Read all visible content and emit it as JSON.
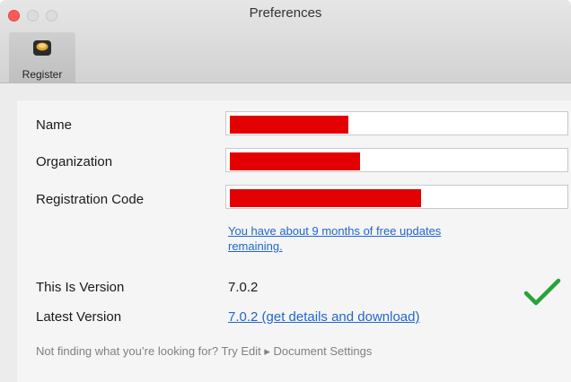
{
  "window": {
    "title": "Preferences"
  },
  "toolbar": {
    "tab_label": "Register",
    "tab_icon": "register-app-icon"
  },
  "form": {
    "name_label": "Name",
    "organization_label": "Organization",
    "registration_code_label": "Registration Code",
    "name_value_redacted": true,
    "organization_value_redacted": true,
    "registration_code_value_redacted": true
  },
  "updates": {
    "line1": "You have about 9 months of free updates",
    "line2": "remaining."
  },
  "version": {
    "this_label": "This Is Version",
    "this_value": "7.0.2",
    "latest_label": "Latest Version",
    "latest_link": "7.0.2 (get details and download)",
    "status_icon": "checkmark-icon",
    "status_color": "#2aa33a"
  },
  "hint": "Not finding what you’re looking for? Try Edit ▸ Document Settings",
  "colors": {
    "redaction": "#e30000",
    "link": "#2266cc"
  }
}
